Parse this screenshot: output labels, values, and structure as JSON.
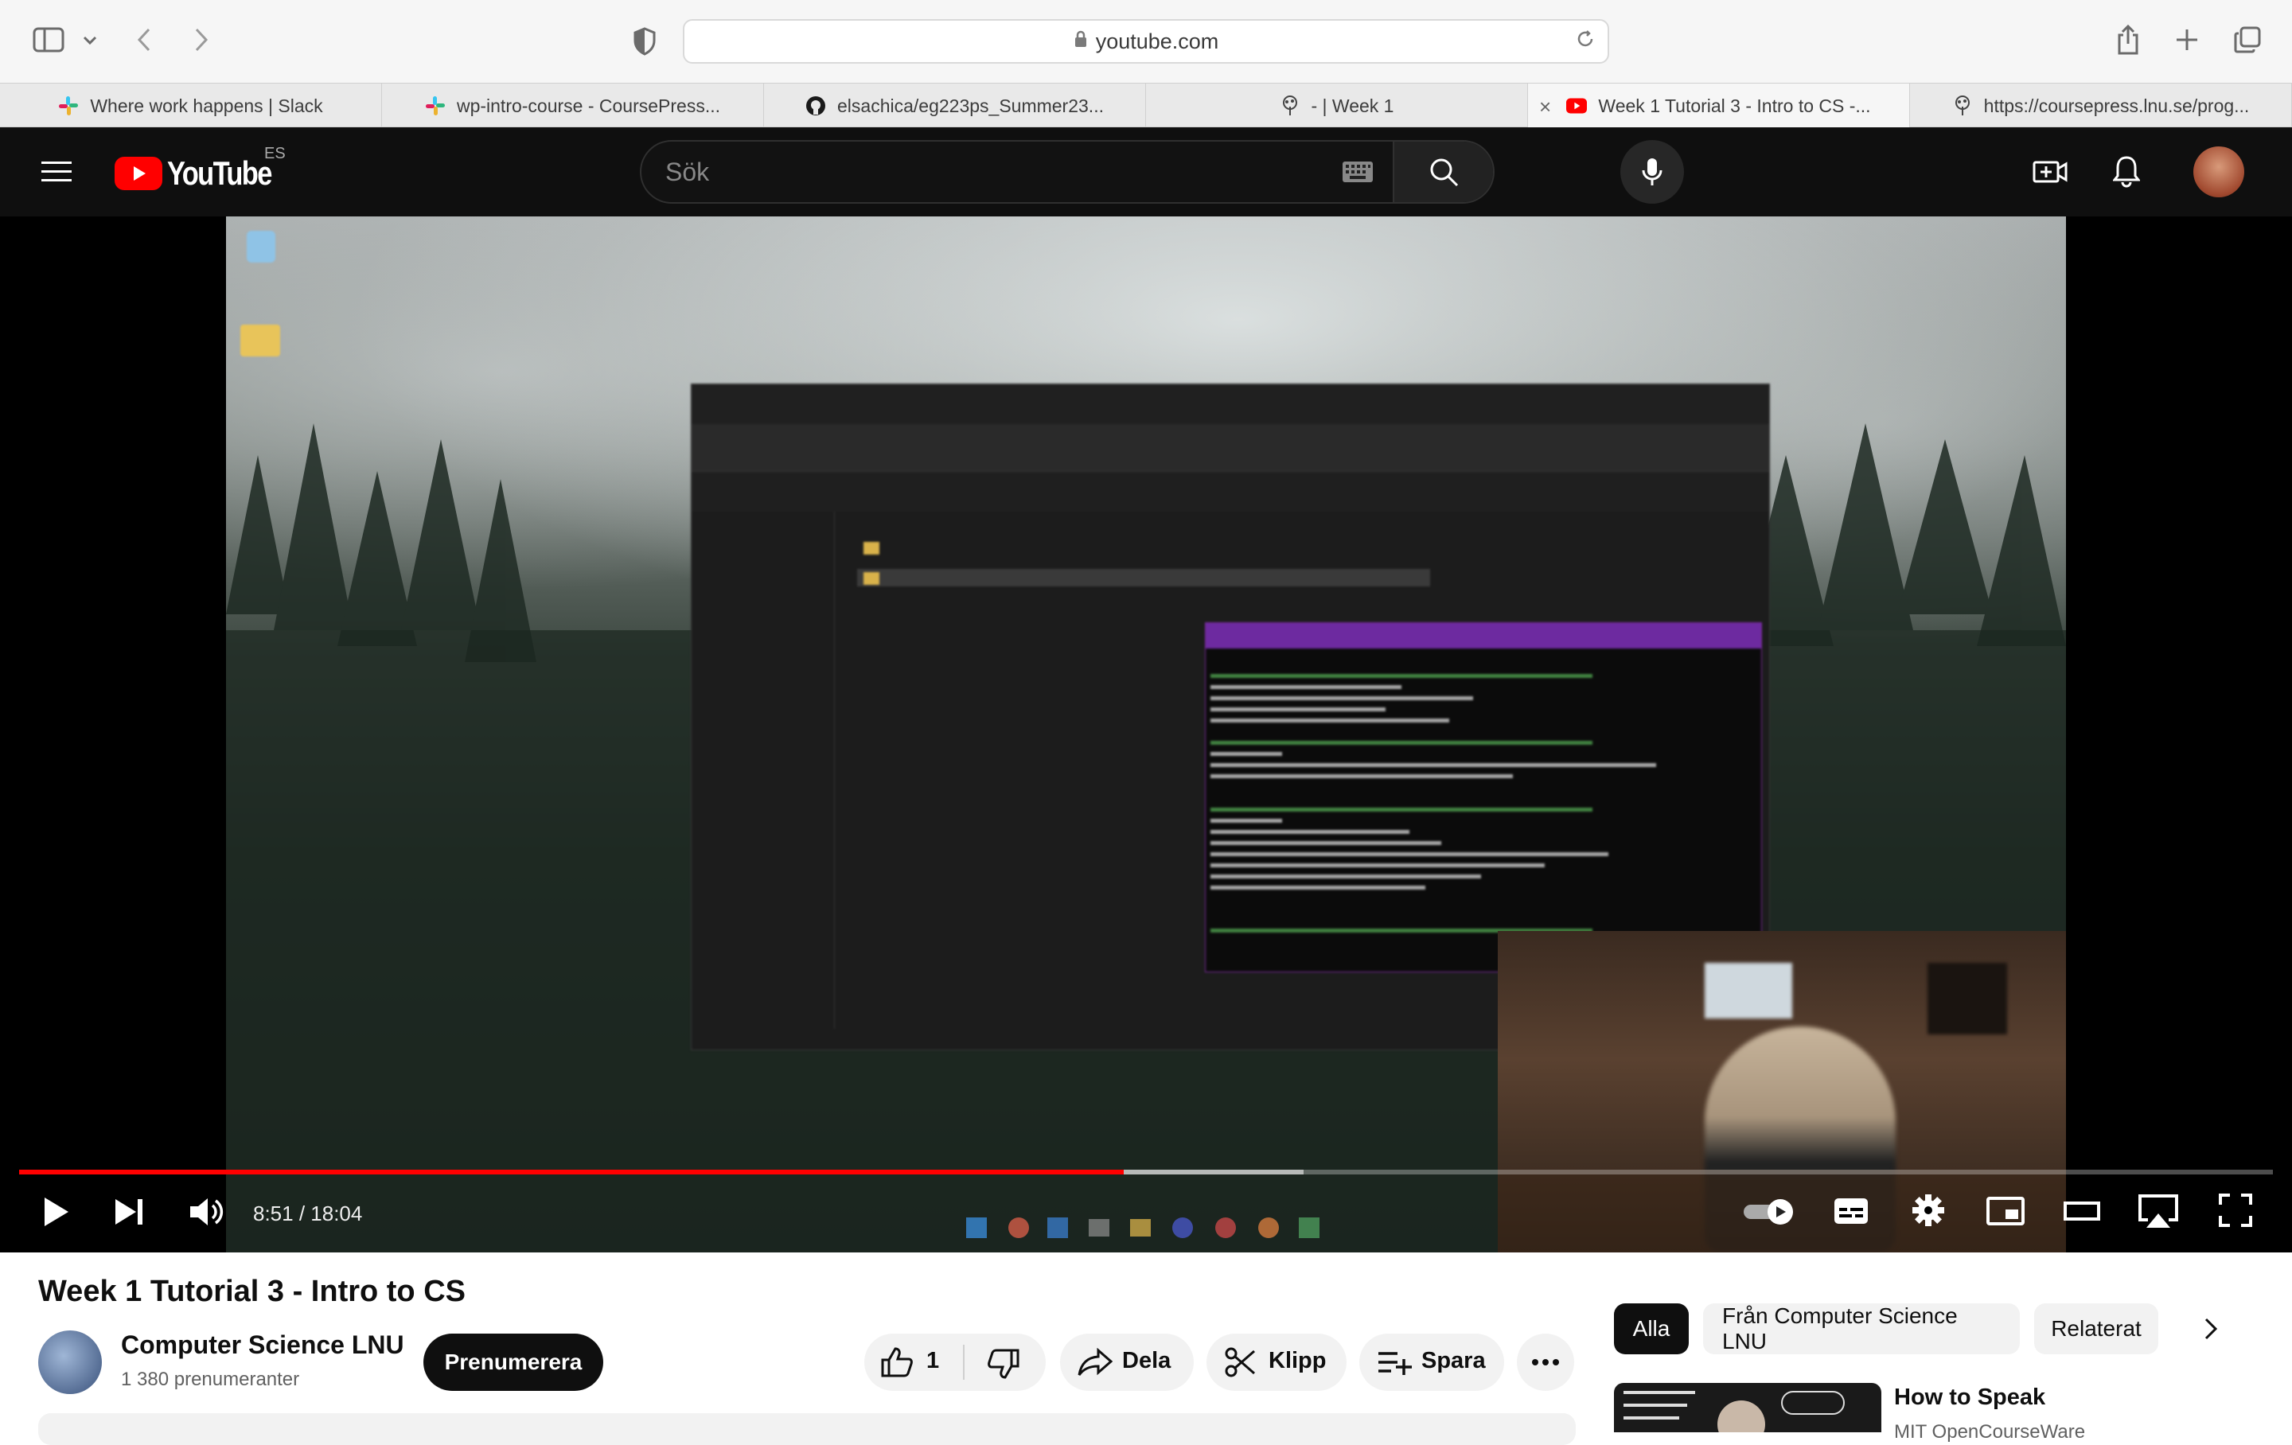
{
  "browser": {
    "url": "youtube.com",
    "tabs": [
      {
        "label": "Where work happens | Slack",
        "icon": "slack-icon",
        "active": false
      },
      {
        "label": "wp-intro-course - CoursePress...",
        "icon": "slack-icon",
        "active": false
      },
      {
        "label": "elsachica/eg223ps_Summer23...",
        "icon": "github-icon",
        "active": false
      },
      {
        "label": "- | Week 1",
        "icon": "tree-icon",
        "active": false
      },
      {
        "label": "Week 1 Tutorial 3 - Intro to CS -...",
        "icon": "youtube-icon",
        "active": true
      },
      {
        "label": "https://coursepress.lnu.se/prog...",
        "icon": "tree-icon",
        "active": false
      }
    ]
  },
  "youtube": {
    "logo_text": "YouTube",
    "country_code": "ES",
    "search_placeholder": "Sök"
  },
  "player": {
    "current_time": "8:51",
    "duration": "18:04",
    "time_display": "8:51 / 18:04",
    "played_fraction": 0.49,
    "buffered_fraction": 0.57
  },
  "video": {
    "title": "Week 1 Tutorial 3 - Intro to CS",
    "channel_name": "Computer Science LNU",
    "subscribers": "1 380 prenumeranter",
    "subscribe_label": "Prenumerera",
    "like_count": "1",
    "share_label": "Dela",
    "clip_label": "Klipp",
    "save_label": "Spara"
  },
  "related": {
    "chips": [
      "Alla",
      "Från Computer Science LNU",
      "Relaterat"
    ],
    "first_title": "How to Speak",
    "first_channel": "MIT OpenCourseWare"
  },
  "colors": {
    "accent_red": "#ff0000",
    "masthead": "#0f0f0f",
    "toolbar": "#f6f6f6"
  }
}
